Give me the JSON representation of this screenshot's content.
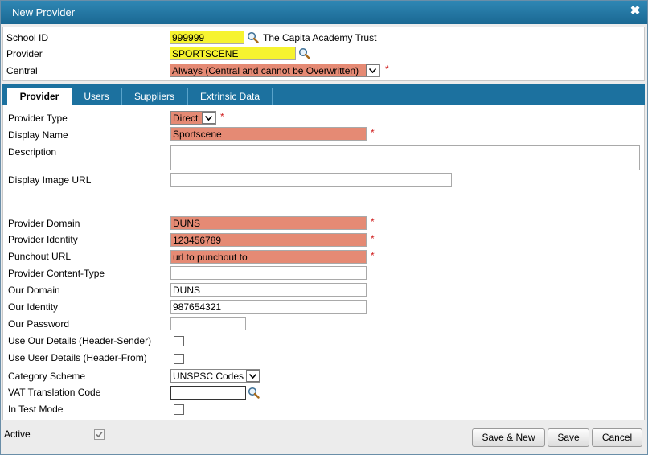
{
  "window": {
    "title": "New Provider"
  },
  "header": {
    "school_id_label": "School ID",
    "school_id_value": "999999",
    "school_name": "The Capita Academy Trust",
    "provider_label": "Provider",
    "provider_value": "SPORTSCENE",
    "central_label": "Central",
    "central_value": "Always (Central and cannot be Overwritten)",
    "required_mark": "*"
  },
  "tabs": [
    {
      "label": "Provider",
      "active": true
    },
    {
      "label": "Users",
      "active": false
    },
    {
      "label": "Suppliers",
      "active": false
    },
    {
      "label": "Extrinsic Data",
      "active": false
    }
  ],
  "form": {
    "provider_type": {
      "label": "Provider Type",
      "value": "Direct"
    },
    "display_name": {
      "label": "Display Name",
      "value": "Sportscene"
    },
    "description": {
      "label": "Description",
      "value": ""
    },
    "display_image_url": {
      "label": "Display Image URL",
      "value": ""
    },
    "provider_domain": {
      "label": "Provider Domain",
      "value": "DUNS"
    },
    "provider_identity": {
      "label": "Provider Identity",
      "value": "123456789"
    },
    "punchout_url": {
      "label": "Punchout URL",
      "value": "url to punchout to"
    },
    "provider_content_type": {
      "label": "Provider Content-Type",
      "value": ""
    },
    "our_domain": {
      "label": "Our Domain",
      "value": "DUNS"
    },
    "our_identity": {
      "label": "Our Identity",
      "value": "987654321"
    },
    "our_password": {
      "label": "Our Password",
      "value": ""
    },
    "use_our_details": {
      "label": "Use Our Details (Header-Sender)",
      "checked": false
    },
    "use_user_details": {
      "label": "Use User Details (Header-From)",
      "checked": false
    },
    "category_scheme": {
      "label": "Category Scheme",
      "value": "UNSPSC Codes"
    },
    "vat_translation_code": {
      "label": "VAT Translation Code",
      "value": ""
    },
    "in_test_mode": {
      "label": "In Test Mode",
      "checked": false
    }
  },
  "footer": {
    "active_label": "Active",
    "active_checked": true,
    "save_new_label": "Save & New",
    "save_label": "Save",
    "cancel_label": "Cancel"
  },
  "colors": {
    "titlebar": "#1c719f",
    "required_field": "#e58a74",
    "highlight_field": "#f6f32f",
    "required_star": "#d02020"
  }
}
